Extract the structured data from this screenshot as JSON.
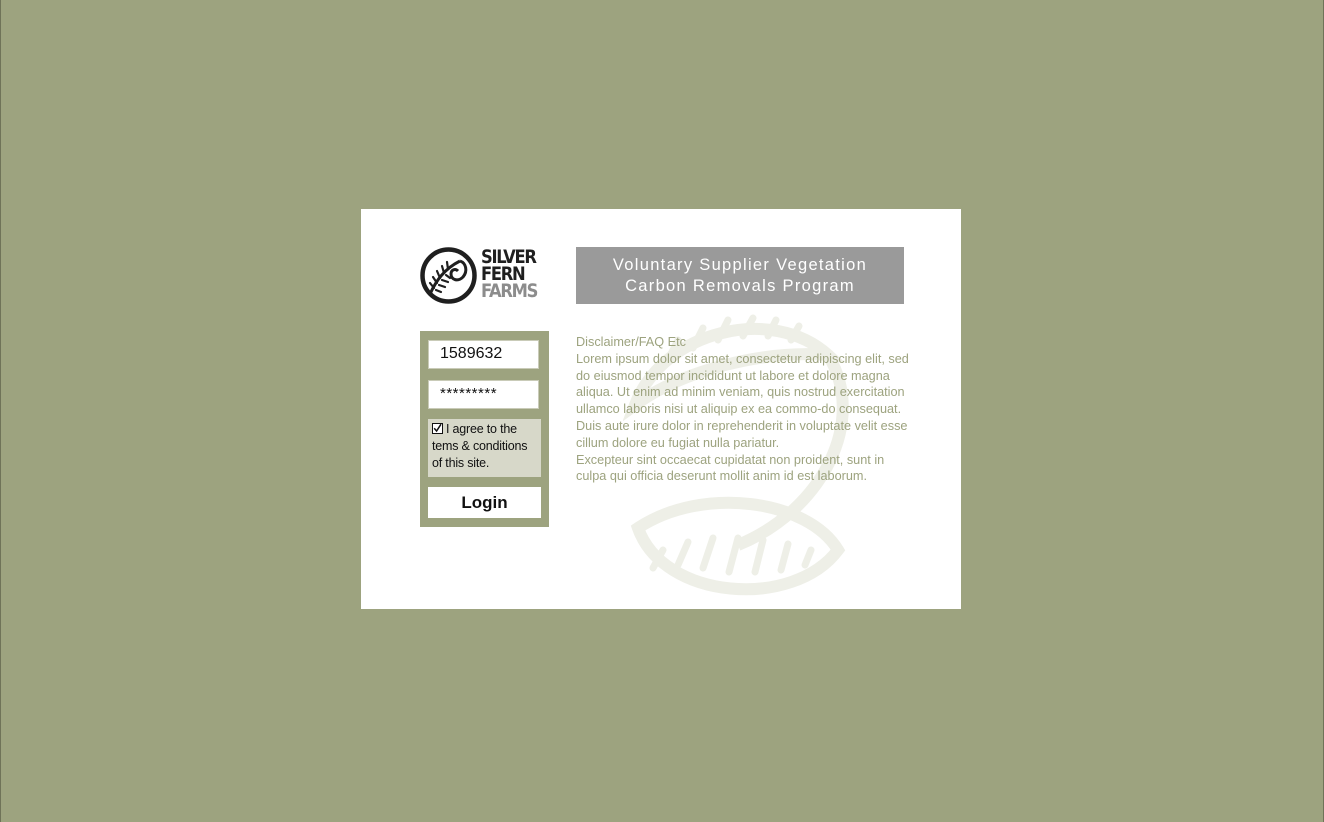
{
  "colors": {
    "background": "#9da37f",
    "card": "#ffffff",
    "banner": "#9a9a9a",
    "disclaimer_text": "#9da37f",
    "agree_box": "#d7d8c9"
  },
  "logo": {
    "line1": "SILVER",
    "line2": "FERN",
    "line3": "FARMS",
    "icon": "fern-icon"
  },
  "banner": {
    "line1": "Voluntary Supplier Vegetation",
    "line2": "Carbon Removals Program"
  },
  "login": {
    "username_value": "1589632",
    "password_value": "*********",
    "agree_checked": true,
    "agree_line1": "I agree to the",
    "agree_line2": "tems & conditions",
    "agree_line3": "of this site.",
    "button_label": "Login"
  },
  "disclaimer": {
    "heading": "Disclaimer/FAQ Etc",
    "paragraph1": "Lorem ipsum dolor sit amet, consectetur adipiscing elit, sed do eiusmod tempor incididunt ut labore et dolore magna aliqua. Ut enim ad minim veniam, quis nostrud exercitation ullamco laboris nisi ut aliquip ex ea commo-do consequat.",
    "paragraph2": "Duis aute irure dolor in reprehenderit in voluptate velit esse cillum dolore eu fugiat nulla pariatur.",
    "paragraph3": "Excepteur sint occaecat cupidatat non proident, sunt in culpa qui officia deserunt mollit anim id est laborum."
  }
}
